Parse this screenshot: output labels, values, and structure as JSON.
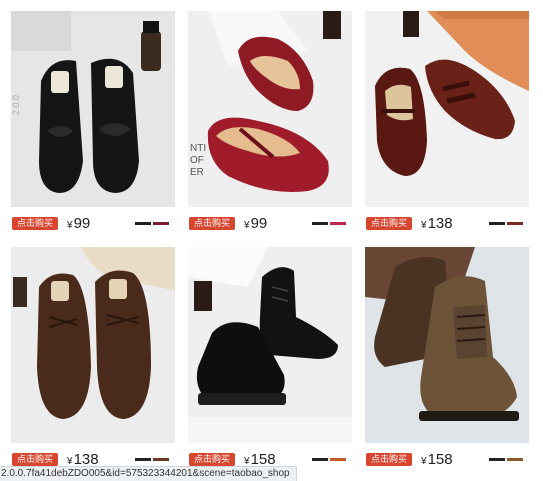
{
  "products": [
    {
      "buy_label": "点击购买",
      "currency": "¥",
      "price": "99",
      "colors": [
        "#222222",
        "#7a1b2e"
      ]
    },
    {
      "buy_label": "点击购买",
      "currency": "¥",
      "price": "99",
      "colors": [
        "#222222",
        "#c0264b"
      ]
    },
    {
      "buy_label": "点击购买",
      "currency": "¥",
      "price": "138",
      "colors": [
        "#222222",
        "#7a2a1f"
      ]
    },
    {
      "buy_label": "点击购买",
      "currency": "¥",
      "price": "138",
      "colors": [
        "#222222",
        "#6b3a24"
      ]
    },
    {
      "buy_label": "点击购买",
      "currency": "¥",
      "price": "158",
      "colors": [
        "#222222",
        "#c55a2a"
      ]
    },
    {
      "buy_label": "点击购买",
      "currency": "¥",
      "price": "158",
      "colors": [
        "#222222",
        "#8a5a2b"
      ]
    }
  ],
  "status_bar": {
    "url": "2.0.0.7fa41debZDO005&id=575323344201&scene=taobao_shop"
  },
  "accent": "#d9462f"
}
